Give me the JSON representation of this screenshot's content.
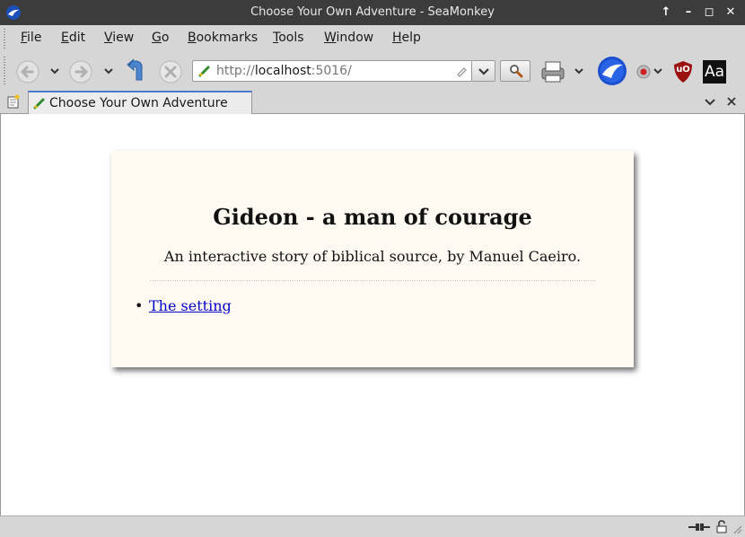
{
  "window": {
    "title": "Choose Your Own Adventure - SeaMonkey"
  },
  "menu": {
    "items": [
      {
        "label": "File",
        "accel": "F"
      },
      {
        "label": "Edit",
        "accel": "E"
      },
      {
        "label": "View",
        "accel": "V"
      },
      {
        "label": "Go",
        "accel": "G"
      },
      {
        "label": "Bookmarks",
        "accel": "B"
      },
      {
        "label": "Tools",
        "accel": "T"
      },
      {
        "label": "Window",
        "accel": "W"
      },
      {
        "label": "Help",
        "accel": "H"
      }
    ]
  },
  "urlbar": {
    "scheme": "http://",
    "host": "localhost",
    "rest": ":5016/"
  },
  "toolbar": {
    "icons": [
      "back-icon",
      "forward-icon",
      "reload-icon",
      "stop-icon",
      "search-icon",
      "print-icon",
      "seamonkey-icon",
      "record-icon",
      "ublock-icon",
      "font-size-icon"
    ],
    "font_button_text": "Aa",
    "ublock_text": "uO"
  },
  "tab": {
    "label": "Choose Your Own Adventure"
  },
  "page": {
    "title": "Gideon - a man of courage",
    "subtitle": "An interactive story of biblical source, by Manuel Caeiro.",
    "links": [
      "The setting"
    ]
  },
  "colors": {
    "titlebar": "#3c3c3c",
    "chrome": "#d6d6d6",
    "card_background": "#fffbf3",
    "link": "#0000cc",
    "tab_accent": "#4a7bd0"
  }
}
